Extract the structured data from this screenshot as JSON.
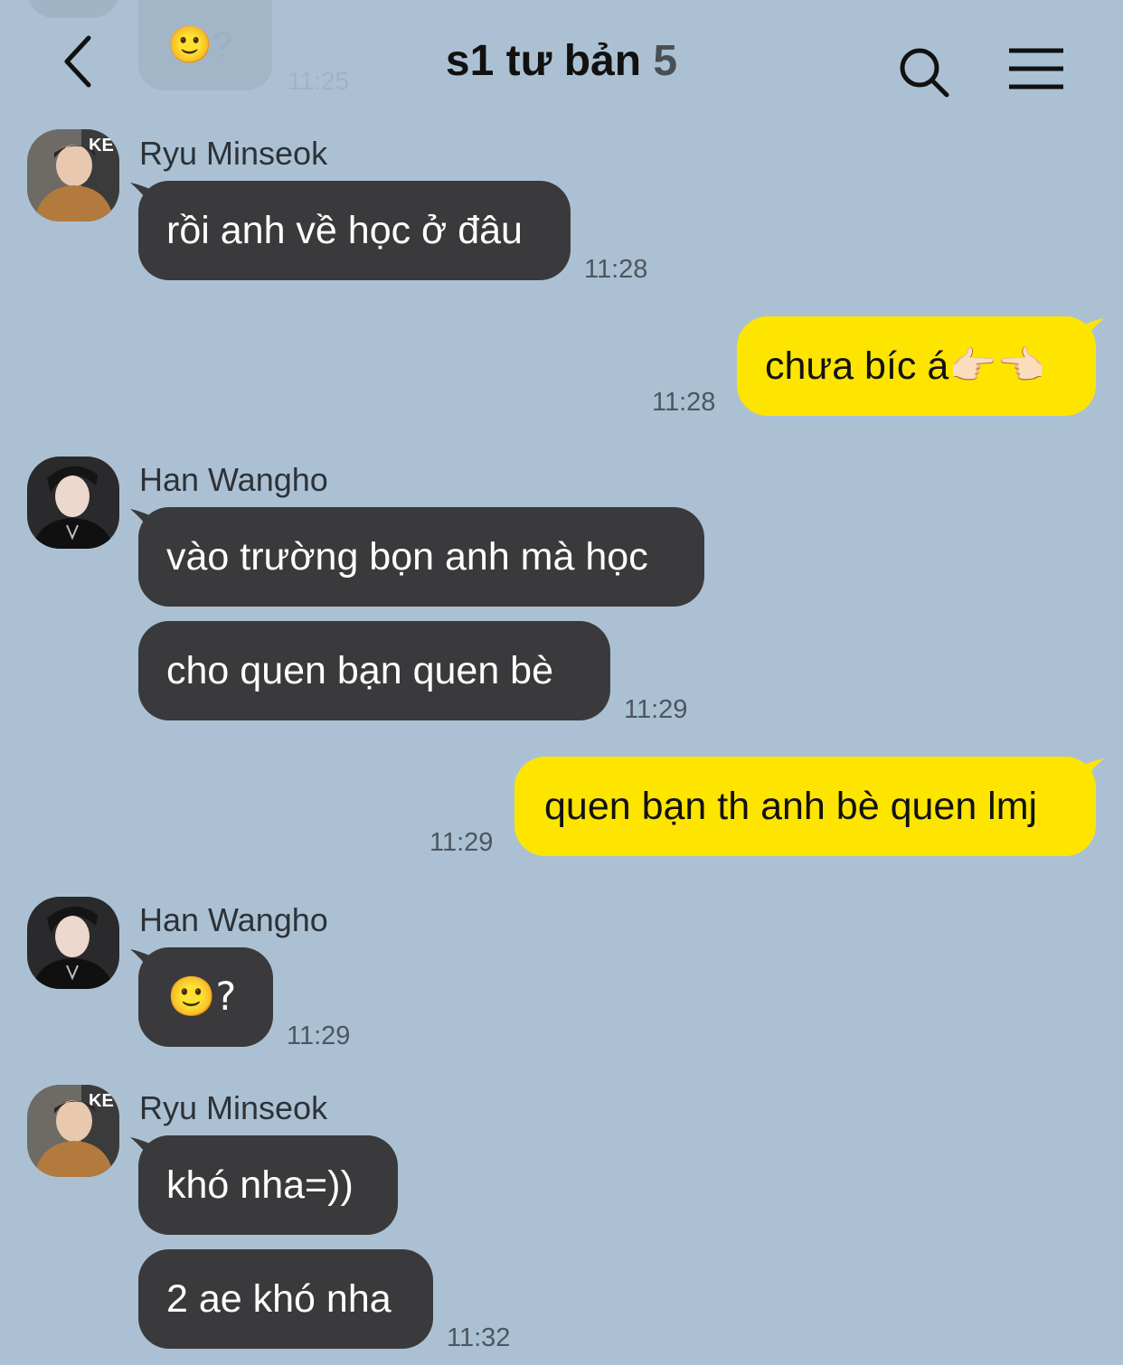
{
  "header": {
    "title": "s1 tư bản",
    "member_count": "5",
    "icons": [
      "chevron-left-icon",
      "search-icon",
      "menu-icon"
    ]
  },
  "ghost": {
    "text": "🙂?",
    "time": "11:25"
  },
  "colors": {
    "background": "#abc1d3",
    "incoming_bubble": "#3a3a3c",
    "outgoing_bubble": "#fee500"
  },
  "messages": [
    {
      "sender": "Ryu Minseok",
      "text": "rồi anh về học ở đâu",
      "time": "11:28"
    },
    {
      "me": true,
      "text": "chưa bíc á👉🏻👈🏻",
      "time": "11:28"
    },
    {
      "sender": "Han Wangho",
      "text": "vào trường bọn anh mà học"
    },
    {
      "text": "cho quen bạn quen bè",
      "time": "11:29"
    },
    {
      "me": true,
      "text": "quen bạn th anh bè quen lmj",
      "time": "11:29"
    },
    {
      "sender": "Han Wangho",
      "text": "🙂?",
      "time": "11:29"
    },
    {
      "sender": "Ryu Minseok",
      "text": "khó nha=))"
    },
    {
      "text": "2 ae khó nha",
      "time": "11:32"
    }
  ]
}
